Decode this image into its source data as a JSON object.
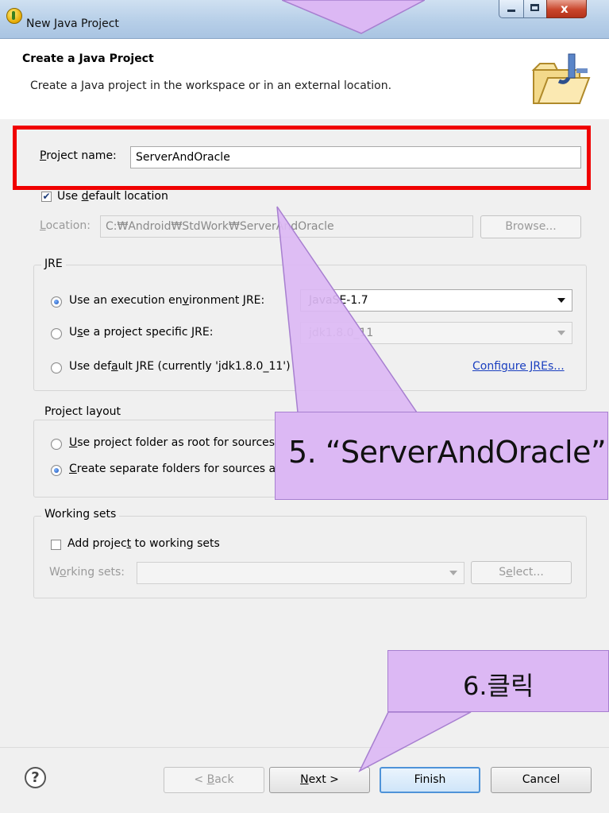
{
  "window": {
    "title": "New Java Project"
  },
  "header": {
    "title": "Create a Java Project",
    "description": "Create a Java project in the workspace or in an external location."
  },
  "project_name": {
    "label_mnemonic": "P",
    "label_rest": "roject name:",
    "value": "ServerAndOracle"
  },
  "default_location": {
    "checked": true,
    "label_prefix": "Use ",
    "label_mnemonic": "d",
    "label_rest": "efault location"
  },
  "location": {
    "label_mnemonic": "L",
    "label_rest": "ocation:",
    "value": "C:₩Android₩StdWork₩ServerAndOracle",
    "browse_label": "Browse..."
  },
  "jre": {
    "group_title": "JRE",
    "options": [
      {
        "prefix": "Use an execution en",
        "mnemonic": "v",
        "rest": "ironment JRE:",
        "selected": true
      },
      {
        "prefix": "U",
        "mnemonic": "s",
        "rest": "e a project specific JRE:",
        "selected": false
      },
      {
        "prefix": "Use def",
        "mnemonic": "a",
        "rest": "ult JRE (currently 'jdk1.8.0_11')",
        "selected": false
      }
    ],
    "env_value": "JavaSE-1.7",
    "specific_value": "jdk1.8.0_11",
    "configure_link": "Configure JREs..."
  },
  "project_layout": {
    "group_title": "Project layout",
    "options": [
      {
        "prefix": "",
        "mnemonic": "U",
        "rest": "se project folder as root for sources and class files",
        "selected": false
      },
      {
        "prefix": "",
        "mnemonic": "C",
        "rest": "reate separate folders for sources and class files",
        "selected": true
      }
    ]
  },
  "working_sets": {
    "group_title": "Working sets",
    "add_checked": false,
    "add_prefix": "Add projec",
    "add_mnemonic": "t",
    "add_rest": " to working sets",
    "label_prefix": "W",
    "label_mnemonic": "o",
    "label_rest": "rking sets:",
    "select_prefix": "S",
    "select_mnemonic": "e",
    "select_rest": "lect..."
  },
  "footer": {
    "help_symbol": "?",
    "back_prefix": "< ",
    "back_mnemonic": "B",
    "back_rest": "ack",
    "next_mnemonic": "N",
    "next_rest": "ext >",
    "finish_label": "Finish",
    "cancel_label": "Cancel"
  },
  "annotations": {
    "step5": "5. “ServerAndOracle”",
    "step6": "6.클릭",
    "highlight_color": "#f00000",
    "callout_color": "#dcb8f4"
  },
  "icons": [
    "java-project-wizard-icon",
    "new-java-project-app-icon",
    "minimize-icon",
    "maximize-icon",
    "close-icon",
    "help-icon"
  ]
}
